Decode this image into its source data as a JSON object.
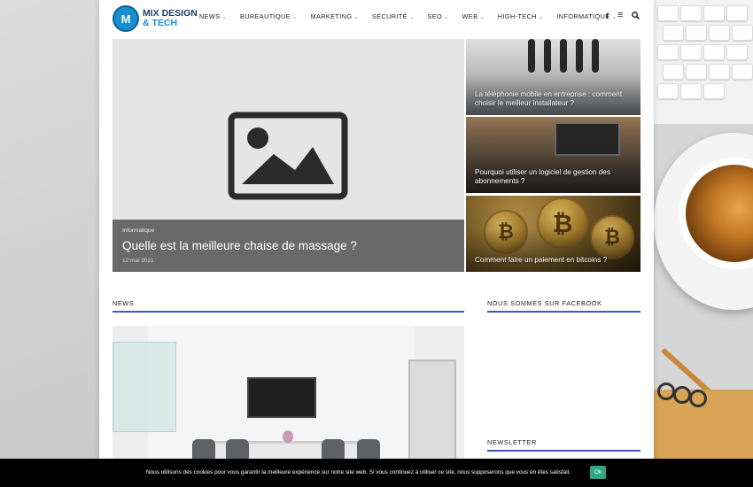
{
  "logo": {
    "badge": "M",
    "line1": "MIX DESIGN",
    "line2": "& TECH"
  },
  "nav": {
    "items": [
      "NEWS",
      "BUREAUTIQUE",
      "MARKETING",
      "SÉCURITÉ",
      "SEO",
      "WEB",
      "HIGH-TECH",
      "INFORMATIQUE"
    ],
    "chevron": "⌄"
  },
  "header_icons": {
    "facebook": "f",
    "menu": "≡",
    "search": "⚲"
  },
  "featured": {
    "category": "Informatique",
    "title": "Quelle est la meilleure chaise de massage ?",
    "date": "12 mai 2021"
  },
  "side_posts": [
    {
      "title": "La téléphonie mobile en entreprise : comment choisir le meilleur installateur ?"
    },
    {
      "title": "Pourquoi utiliser un logiciel de gestion des abonnements ?"
    },
    {
      "title": "Comment faire un paiement en bitcoins ?"
    }
  ],
  "sections": {
    "news": "NEWS",
    "facebook": "NOUS SOMMES SUR FACEBOOK",
    "newsletter": "NEWSLETTER"
  },
  "cookie": {
    "text": "Nous utilisons des cookies pour vous garantir la meilleure expérience sur notre site web. Si vous continuez à utiliser ce site, nous supposerons que vous en êtes satisfait.",
    "button": "Ok"
  },
  "colors": {
    "accent": "#3b5bb5",
    "cookie_button": "#2ea887",
    "logo": "#1a8fd0"
  }
}
